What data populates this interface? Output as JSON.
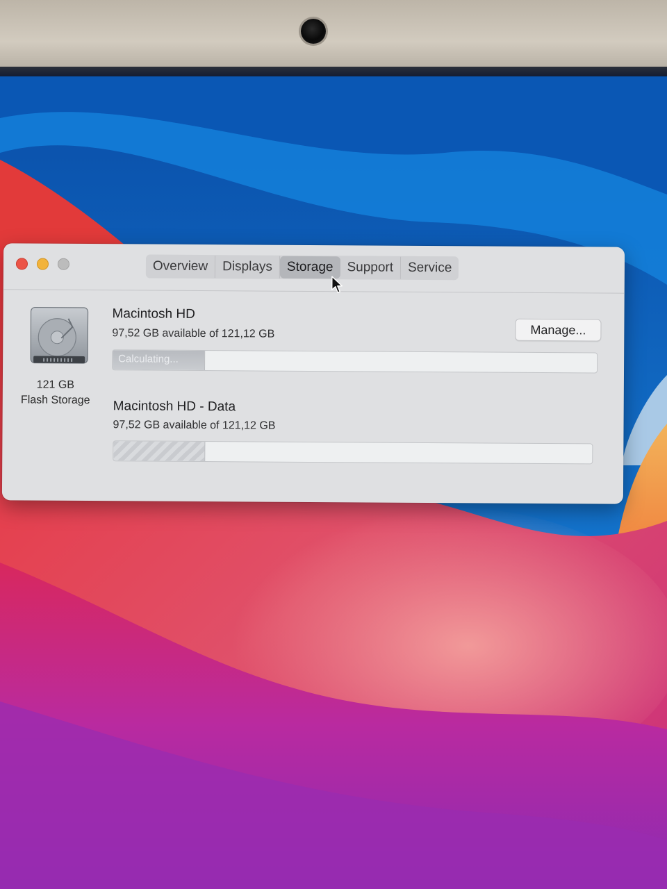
{
  "window": {
    "tabs": [
      "Overview",
      "Displays",
      "Storage",
      "Support",
      "Service"
    ],
    "active_tab": "Storage"
  },
  "disk": {
    "icon": "hard-drive-icon",
    "capacity": "121 GB",
    "type": "Flash Storage"
  },
  "volumes": [
    {
      "name": "Macintosh HD",
      "availability": "97,52 GB available of 121,12 GB",
      "bar_label": "Calculating...",
      "used_fraction": 0.19
    },
    {
      "name": "Macintosh HD - Data",
      "availability": "97,52 GB available of 121,12 GB",
      "used_fraction": 0.19
    }
  ],
  "actions": {
    "manage_label": "Manage..."
  },
  "colors": {
    "close": "#ec5447",
    "minimize": "#f2b33a",
    "zoom_disabled": "#bcbcbc"
  }
}
